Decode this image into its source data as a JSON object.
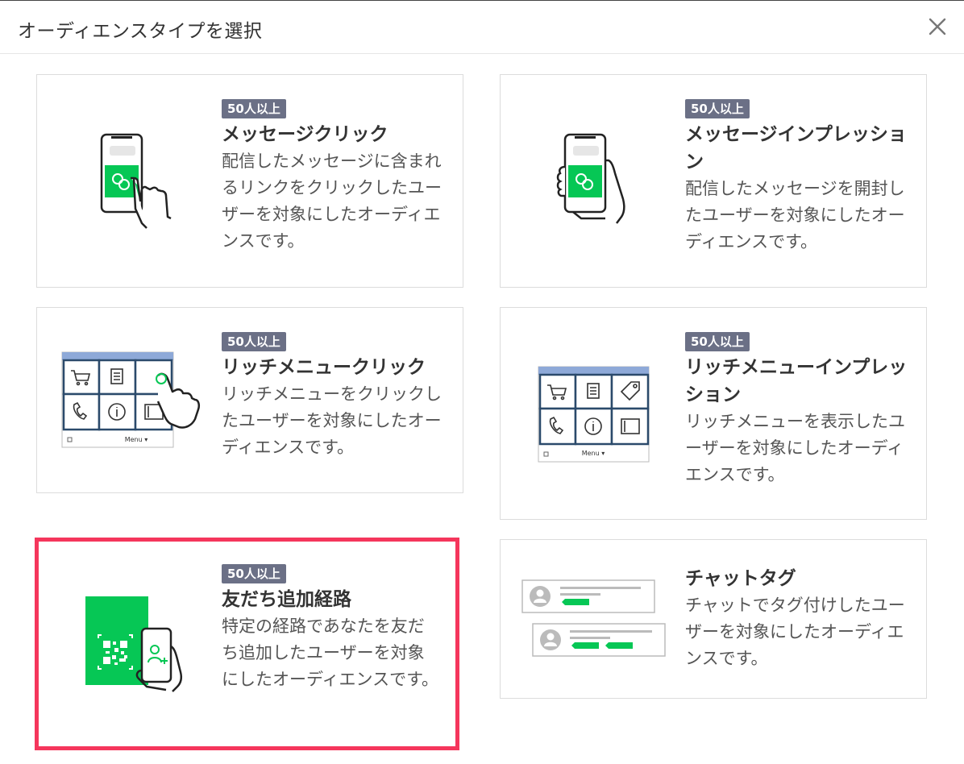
{
  "dialog": {
    "title": "オーディエンスタイプを選択"
  },
  "cards": [
    {
      "badge": "50人以上",
      "title": "メッセージクリック",
      "desc": "配信したメッセージに含まれるリンクをクリックしたユーザーを対象にしたオーディエンスです。"
    },
    {
      "badge": "50人以上",
      "title": "メッセージインプレッション",
      "desc": "配信したメッセージを開封したユーザーを対象にしたオーディエンスです。"
    },
    {
      "badge": "50人以上",
      "title": "リッチメニュークリック",
      "desc": "リッチメニューをクリックしたユーザーを対象にしたオーディエンスです。",
      "menu_label": "Menu ▾"
    },
    {
      "badge": "50人以上",
      "title": "リッチメニューインプレッション",
      "desc": "リッチメニューを表示したユーザーを対象にしたオーディエンスです。",
      "menu_label": "Menu ▾"
    },
    {
      "badge": "50人以上",
      "title": "友だち追加経路",
      "desc": "特定の経路であなたを友だち追加したユーザーを対象にしたオーディエンスです。"
    },
    {
      "title": "チャットタグ",
      "desc": "チャットでタグ付けしたユーザーを対象にしたオーディエンスです。"
    }
  ],
  "colors": {
    "accent_green": "#06c755",
    "badge_bg": "#6b7086",
    "selected_border": "#f5365c",
    "menu_blue": "#8ea9d8",
    "menu_border": "#2b4a6b"
  },
  "icons": [
    "close-icon",
    "phone-tap-icon",
    "phone-hold-icon",
    "rich-menu-tap-icon",
    "rich-menu-icon",
    "qr-friend-add-icon",
    "chat-tag-icon"
  ]
}
